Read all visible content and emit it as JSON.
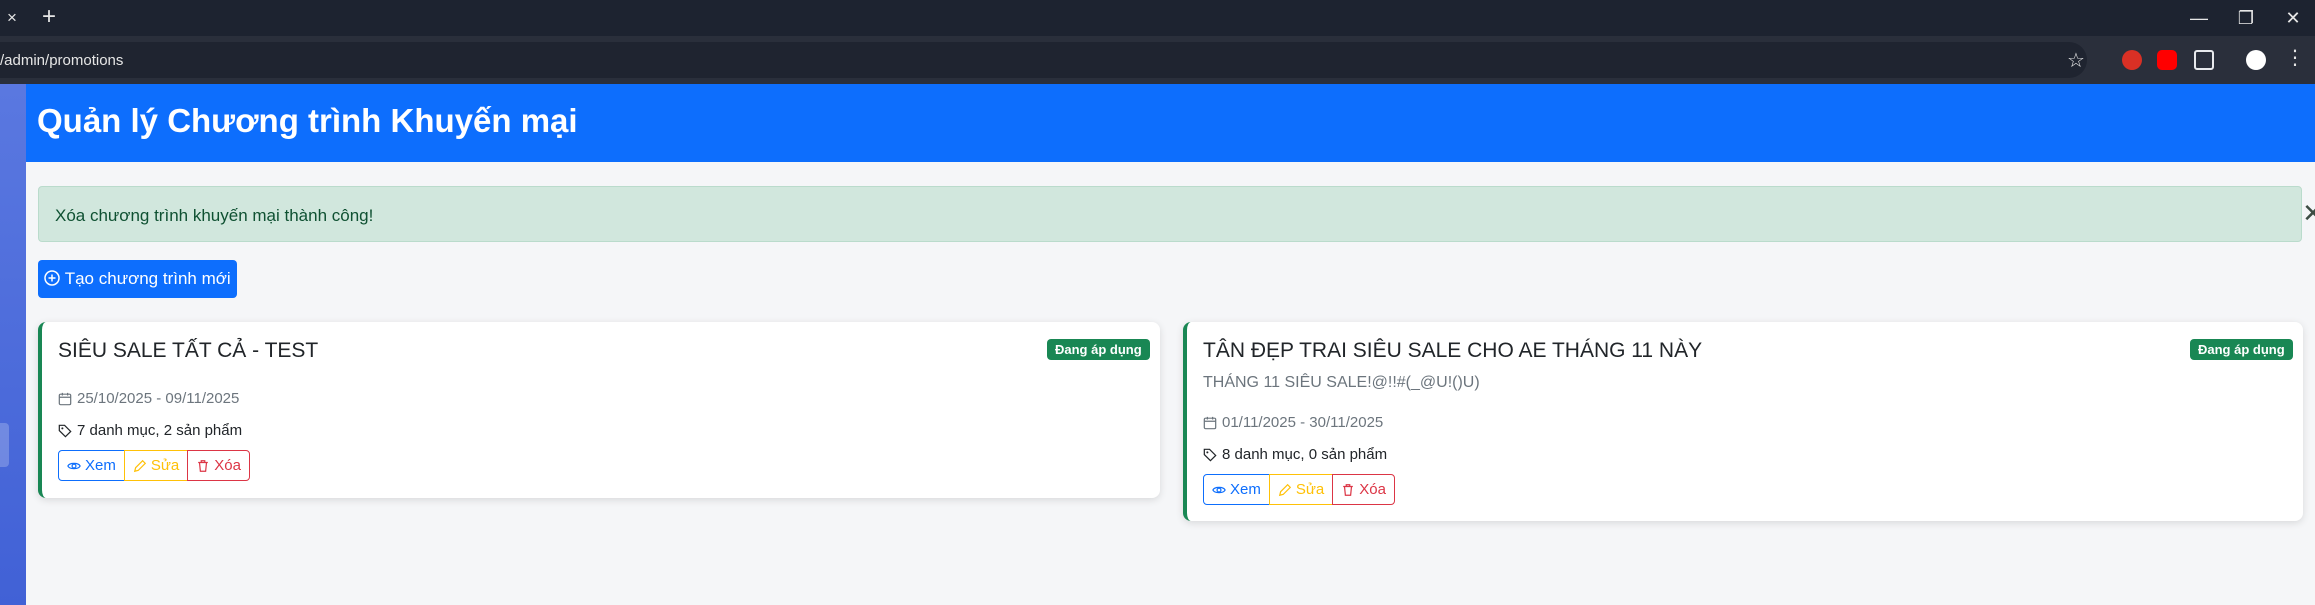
{
  "browser": {
    "tab_close": "×",
    "new_tab": "+",
    "window_controls": [
      "—",
      "❐",
      "✕"
    ],
    "url": "/admin/promotions",
    "bookmark_star": "☆",
    "extensions_menu": "⋮",
    "extension_colors": [
      "#d93025",
      "#ff0000",
      "#e8eaed",
      "#ffffff"
    ]
  },
  "page": {
    "title": "Quản lý Chương trình Khuyến mại"
  },
  "alert": {
    "message": "Xóa chương trình khuyến mại thành công!",
    "close": "✕"
  },
  "create_button": {
    "label": "Tạo chương trình mới"
  },
  "colors": {
    "primary": "#0d6efd",
    "success": "#198754",
    "warning": "#ffc107",
    "danger": "#dc3545"
  },
  "promotions": [
    {
      "title": "SIÊU SALE TẤT CẢ - TEST",
      "status": "Đang áp dụng",
      "dates": "25/10/2025 - 09/11/2025",
      "scope": "7 danh mục, 2 sản phẩm",
      "actions": {
        "view": "Xem",
        "edit": "Sửa",
        "delete": "Xóa"
      }
    },
    {
      "title": "TÂN ĐẸP TRAI SIÊU SALE CHO AE THÁNG 11 NÀY",
      "status": "Đang áp dụng",
      "description": "THÁNG 11 SIÊU SALE!@!!#(_@U!()U)",
      "dates": "01/11/2025 - 30/11/2025",
      "scope": "8 danh mục, 0 sản phẩm",
      "actions": {
        "view": "Xem",
        "edit": "Sửa",
        "delete": "Xóa"
      }
    }
  ]
}
